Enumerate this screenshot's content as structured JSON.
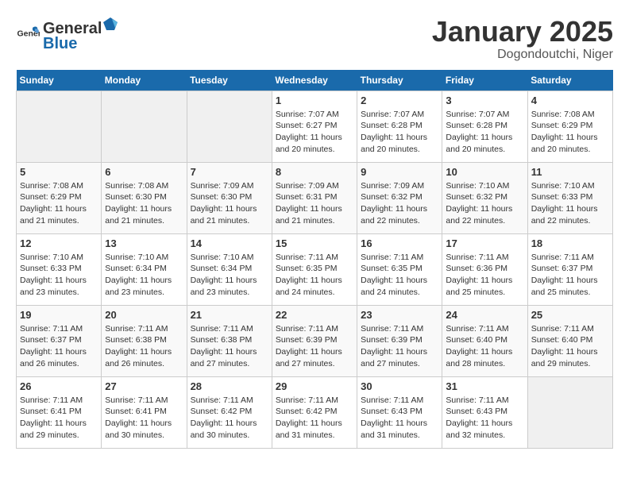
{
  "header": {
    "logo_general": "General",
    "logo_blue": "Blue",
    "month": "January 2025",
    "location": "Dogondoutchi, Niger"
  },
  "weekdays": [
    "Sunday",
    "Monday",
    "Tuesday",
    "Wednesday",
    "Thursday",
    "Friday",
    "Saturday"
  ],
  "weeks": [
    [
      {
        "day": "",
        "sunrise": "",
        "sunset": "",
        "daylight": ""
      },
      {
        "day": "",
        "sunrise": "",
        "sunset": "",
        "daylight": ""
      },
      {
        "day": "",
        "sunrise": "",
        "sunset": "",
        "daylight": ""
      },
      {
        "day": "1",
        "sunrise": "Sunrise: 7:07 AM",
        "sunset": "Sunset: 6:27 PM",
        "daylight": "Daylight: 11 hours and 20 minutes."
      },
      {
        "day": "2",
        "sunrise": "Sunrise: 7:07 AM",
        "sunset": "Sunset: 6:28 PM",
        "daylight": "Daylight: 11 hours and 20 minutes."
      },
      {
        "day": "3",
        "sunrise": "Sunrise: 7:07 AM",
        "sunset": "Sunset: 6:28 PM",
        "daylight": "Daylight: 11 hours and 20 minutes."
      },
      {
        "day": "4",
        "sunrise": "Sunrise: 7:08 AM",
        "sunset": "Sunset: 6:29 PM",
        "daylight": "Daylight: 11 hours and 20 minutes."
      }
    ],
    [
      {
        "day": "5",
        "sunrise": "Sunrise: 7:08 AM",
        "sunset": "Sunset: 6:29 PM",
        "daylight": "Daylight: 11 hours and 21 minutes."
      },
      {
        "day": "6",
        "sunrise": "Sunrise: 7:08 AM",
        "sunset": "Sunset: 6:30 PM",
        "daylight": "Daylight: 11 hours and 21 minutes."
      },
      {
        "day": "7",
        "sunrise": "Sunrise: 7:09 AM",
        "sunset": "Sunset: 6:30 PM",
        "daylight": "Daylight: 11 hours and 21 minutes."
      },
      {
        "day": "8",
        "sunrise": "Sunrise: 7:09 AM",
        "sunset": "Sunset: 6:31 PM",
        "daylight": "Daylight: 11 hours and 21 minutes."
      },
      {
        "day": "9",
        "sunrise": "Sunrise: 7:09 AM",
        "sunset": "Sunset: 6:32 PM",
        "daylight": "Daylight: 11 hours and 22 minutes."
      },
      {
        "day": "10",
        "sunrise": "Sunrise: 7:10 AM",
        "sunset": "Sunset: 6:32 PM",
        "daylight": "Daylight: 11 hours and 22 minutes."
      },
      {
        "day": "11",
        "sunrise": "Sunrise: 7:10 AM",
        "sunset": "Sunset: 6:33 PM",
        "daylight": "Daylight: 11 hours and 22 minutes."
      }
    ],
    [
      {
        "day": "12",
        "sunrise": "Sunrise: 7:10 AM",
        "sunset": "Sunset: 6:33 PM",
        "daylight": "Daylight: 11 hours and 23 minutes."
      },
      {
        "day": "13",
        "sunrise": "Sunrise: 7:10 AM",
        "sunset": "Sunset: 6:34 PM",
        "daylight": "Daylight: 11 hours and 23 minutes."
      },
      {
        "day": "14",
        "sunrise": "Sunrise: 7:10 AM",
        "sunset": "Sunset: 6:34 PM",
        "daylight": "Daylight: 11 hours and 23 minutes."
      },
      {
        "day": "15",
        "sunrise": "Sunrise: 7:11 AM",
        "sunset": "Sunset: 6:35 PM",
        "daylight": "Daylight: 11 hours and 24 minutes."
      },
      {
        "day": "16",
        "sunrise": "Sunrise: 7:11 AM",
        "sunset": "Sunset: 6:35 PM",
        "daylight": "Daylight: 11 hours and 24 minutes."
      },
      {
        "day": "17",
        "sunrise": "Sunrise: 7:11 AM",
        "sunset": "Sunset: 6:36 PM",
        "daylight": "Daylight: 11 hours and 25 minutes."
      },
      {
        "day": "18",
        "sunrise": "Sunrise: 7:11 AM",
        "sunset": "Sunset: 6:37 PM",
        "daylight": "Daylight: 11 hours and 25 minutes."
      }
    ],
    [
      {
        "day": "19",
        "sunrise": "Sunrise: 7:11 AM",
        "sunset": "Sunset: 6:37 PM",
        "daylight": "Daylight: 11 hours and 26 minutes."
      },
      {
        "day": "20",
        "sunrise": "Sunrise: 7:11 AM",
        "sunset": "Sunset: 6:38 PM",
        "daylight": "Daylight: 11 hours and 26 minutes."
      },
      {
        "day": "21",
        "sunrise": "Sunrise: 7:11 AM",
        "sunset": "Sunset: 6:38 PM",
        "daylight": "Daylight: 11 hours and 27 minutes."
      },
      {
        "day": "22",
        "sunrise": "Sunrise: 7:11 AM",
        "sunset": "Sunset: 6:39 PM",
        "daylight": "Daylight: 11 hours and 27 minutes."
      },
      {
        "day": "23",
        "sunrise": "Sunrise: 7:11 AM",
        "sunset": "Sunset: 6:39 PM",
        "daylight": "Daylight: 11 hours and 27 minutes."
      },
      {
        "day": "24",
        "sunrise": "Sunrise: 7:11 AM",
        "sunset": "Sunset: 6:40 PM",
        "daylight": "Daylight: 11 hours and 28 minutes."
      },
      {
        "day": "25",
        "sunrise": "Sunrise: 7:11 AM",
        "sunset": "Sunset: 6:40 PM",
        "daylight": "Daylight: 11 hours and 29 minutes."
      }
    ],
    [
      {
        "day": "26",
        "sunrise": "Sunrise: 7:11 AM",
        "sunset": "Sunset: 6:41 PM",
        "daylight": "Daylight: 11 hours and 29 minutes."
      },
      {
        "day": "27",
        "sunrise": "Sunrise: 7:11 AM",
        "sunset": "Sunset: 6:41 PM",
        "daylight": "Daylight: 11 hours and 30 minutes."
      },
      {
        "day": "28",
        "sunrise": "Sunrise: 7:11 AM",
        "sunset": "Sunset: 6:42 PM",
        "daylight": "Daylight: 11 hours and 30 minutes."
      },
      {
        "day": "29",
        "sunrise": "Sunrise: 7:11 AM",
        "sunset": "Sunset: 6:42 PM",
        "daylight": "Daylight: 11 hours and 31 minutes."
      },
      {
        "day": "30",
        "sunrise": "Sunrise: 7:11 AM",
        "sunset": "Sunset: 6:43 PM",
        "daylight": "Daylight: 11 hours and 31 minutes."
      },
      {
        "day": "31",
        "sunrise": "Sunrise: 7:11 AM",
        "sunset": "Sunset: 6:43 PM",
        "daylight": "Daylight: 11 hours and 32 minutes."
      },
      {
        "day": "",
        "sunrise": "",
        "sunset": "",
        "daylight": ""
      }
    ]
  ]
}
